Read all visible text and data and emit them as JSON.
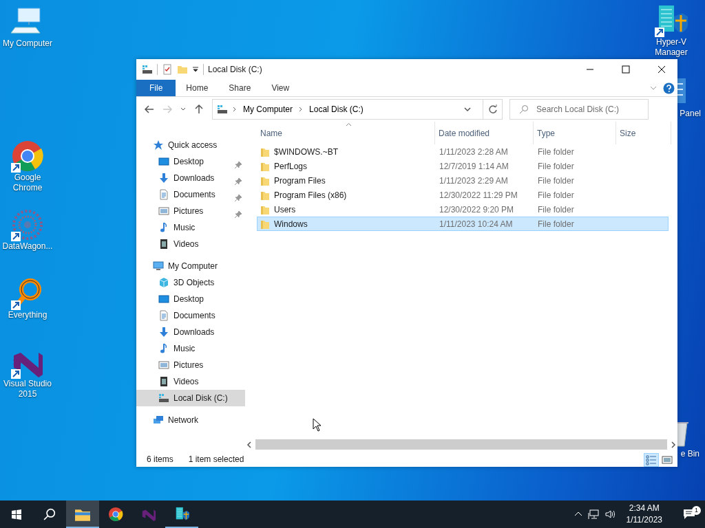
{
  "desktop_icons": [
    {
      "kind": "computer",
      "label": "My Computer",
      "shortcut": false
    },
    {
      "kind": "chrome",
      "label": "Google Chrome",
      "shortcut": true
    },
    {
      "kind": "datawagon",
      "label": "DataWagon...",
      "shortcut": true
    },
    {
      "kind": "everything",
      "label": "Everything",
      "shortcut": true
    },
    {
      "kind": "vs",
      "label": "Visual Studio 2015",
      "shortcut": true
    },
    {
      "kind": "hyperv",
      "label": "Hyper-V Manager",
      "shortcut": true
    },
    {
      "kind": "panel",
      "label": "Panel"
    },
    {
      "kind": "bin",
      "label": "e Bin"
    }
  ],
  "window": {
    "title": "Local Disk (C:)",
    "ribbon_tabs": [
      {
        "label": "File",
        "kind": "file"
      },
      {
        "label": "Home",
        "kind": "tab"
      },
      {
        "label": "Share",
        "kind": "tab"
      },
      {
        "label": "View",
        "kind": "tab"
      }
    ],
    "nav_buttons": [
      {
        "kind": "back",
        "disabled": false
      },
      {
        "kind": "forward",
        "disabled": true
      },
      {
        "kind": "recent",
        "disabled": false
      },
      {
        "kind": "up",
        "disabled": false
      }
    ],
    "address": {
      "crumbs": [
        "My Computer",
        "Local Disk (C:)"
      ]
    },
    "search": {
      "placeholder": "Search Local Disk (C:)"
    },
    "nav": [
      {
        "label": "Quick access",
        "kind": "star",
        "selected": false,
        "children": [
          {
            "label": "Desktop",
            "kind": "desktop",
            "pinned": true,
            "selected": false
          },
          {
            "label": "Downloads",
            "kind": "download",
            "pinned": true,
            "selected": false
          },
          {
            "label": "Documents",
            "kind": "document",
            "pinned": true,
            "selected": false
          },
          {
            "label": "Pictures",
            "kind": "picture",
            "pinned": true,
            "selected": false
          },
          {
            "label": "Music",
            "kind": "music",
            "pinned": false,
            "selected": false
          },
          {
            "label": "Videos",
            "kind": "video",
            "pinned": false,
            "selected": false
          }
        ]
      },
      {
        "label": "My Computer",
        "kind": "computer",
        "selected": false,
        "children": [
          {
            "label": "3D Objects",
            "kind": "cube",
            "pinned": false,
            "selected": false
          },
          {
            "label": "Desktop",
            "kind": "desktop",
            "pinned": false,
            "selected": false
          },
          {
            "label": "Documents",
            "kind": "document",
            "pinned": false,
            "selected": false
          },
          {
            "label": "Downloads",
            "kind": "download",
            "pinned": false,
            "selected": false
          },
          {
            "label": "Music",
            "kind": "music",
            "pinned": false,
            "selected": false
          },
          {
            "label": "Pictures",
            "kind": "picture",
            "pinned": false,
            "selected": false
          },
          {
            "label": "Videos",
            "kind": "video",
            "pinned": false,
            "selected": false
          },
          {
            "label": "Local Disk (C:)",
            "kind": "drive",
            "pinned": false,
            "selected": true
          }
        ]
      },
      {
        "label": "Network",
        "kind": "network",
        "selected": false
      }
    ],
    "columns": [
      {
        "label": "Name",
        "sorted": true
      },
      {
        "label": "Date modified",
        "sorted": false
      },
      {
        "label": "Type",
        "sorted": false
      },
      {
        "label": "Size",
        "sorted": false
      }
    ],
    "rows": [
      {
        "name": "$WINDOWS.~BT",
        "date": "1/11/2023 2:28 AM",
        "type": "File folder",
        "selected": false
      },
      {
        "name": "PerfLogs",
        "date": "12/7/2019 1:14 AM",
        "type": "File folder",
        "selected": false
      },
      {
        "name": "Program Files",
        "date": "1/11/2023 2:29 AM",
        "type": "File folder",
        "selected": false
      },
      {
        "name": "Program Files (x86)",
        "date": "12/30/2022 11:29 PM",
        "type": "File folder",
        "selected": false
      },
      {
        "name": "Users",
        "date": "12/30/2022 9:20 PM",
        "type": "File folder",
        "selected": false
      },
      {
        "name": "Windows",
        "date": "1/11/2023 10:24 AM",
        "type": "File folder",
        "selected": true
      }
    ],
    "status": {
      "count": "6 items",
      "selection": "1 item selected"
    },
    "views": [
      {
        "kind": "details",
        "selected": true
      },
      {
        "kind": "tiles",
        "selected": false
      }
    ]
  },
  "taskbar": {
    "apps": [
      {
        "kind": "start",
        "running": false,
        "selected": false
      },
      {
        "kind": "search",
        "running": false,
        "selected": false
      },
      {
        "kind": "explorer",
        "running": true,
        "selected": true
      },
      {
        "kind": "chrome",
        "running": false,
        "selected": false
      },
      {
        "kind": "vs",
        "running": false,
        "selected": false
      },
      {
        "kind": "hyperv",
        "running": true,
        "selected": false
      }
    ],
    "time": "2:34 AM",
    "date": "1/11/2023",
    "notifications": "1"
  }
}
